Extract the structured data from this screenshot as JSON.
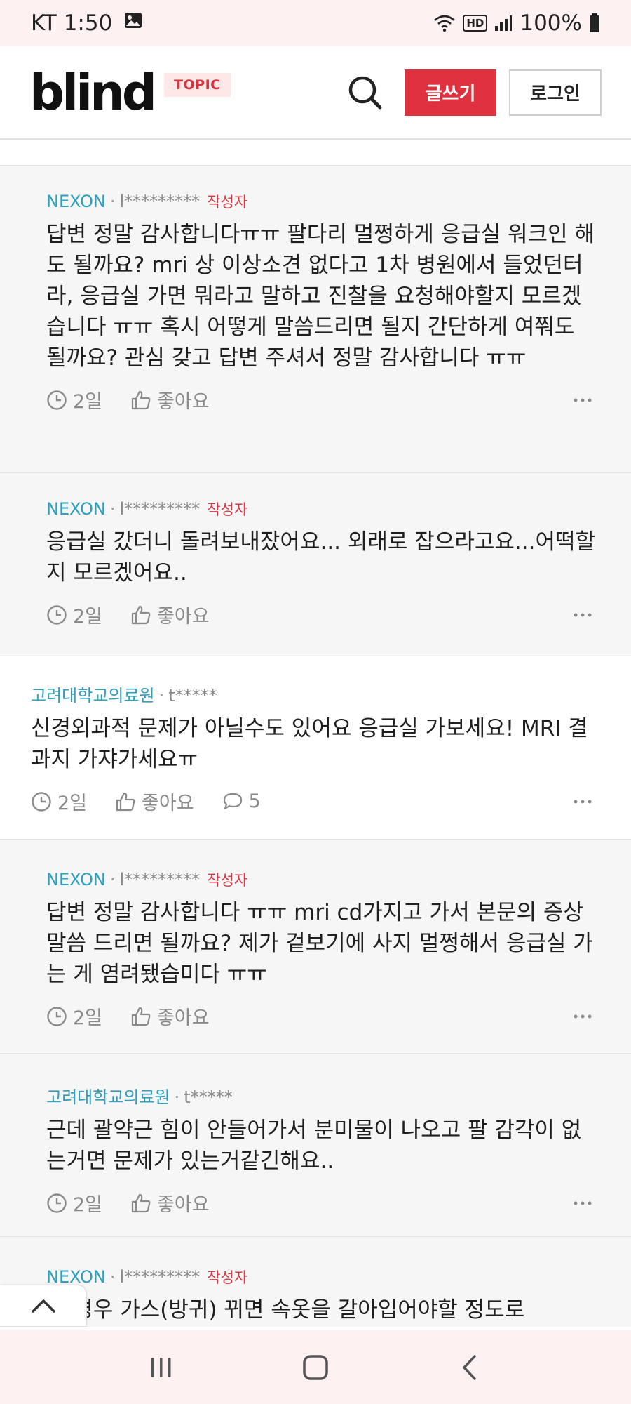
{
  "status_bar": {
    "carrier_time": "KT 1:50",
    "battery": "100%",
    "hd_label": "HD"
  },
  "header": {
    "logo": "blind",
    "topic_badge": "TOPIC",
    "write_label": "글쓰기",
    "login_label": "로그인"
  },
  "comments": [
    {
      "company": "NEXON",
      "nickname": "l*********",
      "author_tag": "작성자",
      "text": "답변 정말 감사합니다ㅠㅠ 팔다리 멀쩡하게 응급실 워크인 해도 될까요? mri 상 이상소견 없다고 1차 병원에서 들었던터라, 응급실 가면 뭐라고 말하고 진찰을 요청해야할지 모르겠습니다 ㅠㅠ 혹시 어떻게 말씀드리면 될지 간단하게 여쭤도 될까요? 관심 갖고 답변 주셔서 정말 감사합니다 ㅠㅠ",
      "time": "2일",
      "like_label": "좋아요"
    },
    {
      "company": "NEXON",
      "nickname": "l*********",
      "author_tag": "작성자",
      "text": "응급실 갔더니 돌려보내잤어요... 외래로 잡으라고요...어떡할지 모르겠어요..",
      "time": "2일",
      "like_label": "좋아요"
    },
    {
      "company": "고려대학교의료원",
      "nickname": "t*****",
      "text": "신경외과적 문제가 아닐수도 있어요 응급실 가보세요! MRI 결과지 가쟈가세요ㅠ",
      "time": "2일",
      "like_label": "좋아요",
      "reply_count": "5"
    },
    {
      "company": "NEXON",
      "nickname": "l*********",
      "author_tag": "작성자",
      "text": "답변 정말 감사합니다 ㅠㅠ mri cd가지고 가서 본문의 증상 말씀 드리면 될까요? 제가 겉보기에 사지 멀쩡해서 응급실 가는 게 염려됐습미다 ㅠㅠ",
      "time": "2일",
      "like_label": "좋아요"
    },
    {
      "company": "고려대학교의료원",
      "nickname": "t*****",
      "text": "근데 괄약근 힘이 안들어가서 분미물이 나오고 팔 감각이 없는거면 문제가 있는거같긴해요..",
      "time": "2일",
      "like_label": "좋아요"
    },
    {
      "company": "NEXON",
      "nickname": "l*********",
      "author_tag": "작성자",
      "text": "제 경우 가스(방귀) 뀌면 속옷을 갈아입어야할 정도로"
    }
  ],
  "icons": {
    "clock": "clock-icon",
    "thumb": "thumbs-up-icon",
    "speech": "comment-icon",
    "more": "more-dots-icon",
    "search": "search-icon",
    "up": "chevron-up-icon"
  },
  "colors": {
    "accent": "#e0323e",
    "company": "#2e9fbd",
    "author_tag": "#d63a45",
    "reply_bg": "#f6f6f7"
  }
}
